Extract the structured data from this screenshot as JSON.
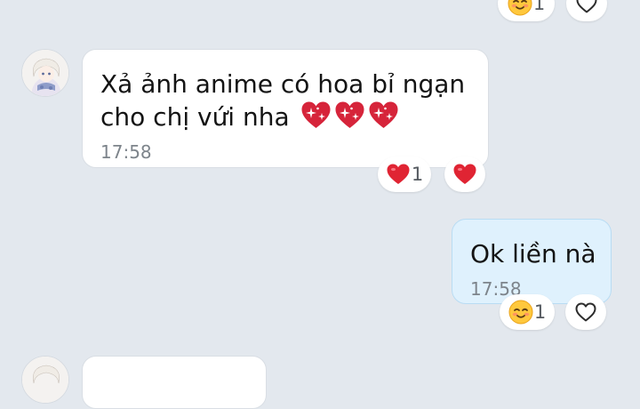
{
  "messages": [
    {
      "sender": "other",
      "text": "Xả ảnh anime có hoa bỉ ngạn\ncho chị vứi nha",
      "emoji": [
        "sparkling-heart",
        "sparkling-heart",
        "sparkling-heart"
      ],
      "time": "17:58",
      "reaction": {
        "emoji": "red-heart",
        "count": "1"
      },
      "action_icon": "red-heart"
    },
    {
      "sender": "me",
      "text": "Ok liền nà",
      "time": "17:58",
      "reaction": {
        "emoji": "smiling-face",
        "count": "1"
      },
      "action_icon": "heart-outline"
    }
  ],
  "partial_top": {
    "reaction": {
      "emoji": "smiling-face",
      "count": "1"
    },
    "action_icon": "heart-outline"
  },
  "colors": {
    "background": "#e3e8ee",
    "incoming_bubble": "#ffffff",
    "outgoing_bubble": "#dff1fd",
    "outgoing_border": "#b9dcf3",
    "heart_red": "#e02433",
    "time_text": "#7d848b"
  }
}
